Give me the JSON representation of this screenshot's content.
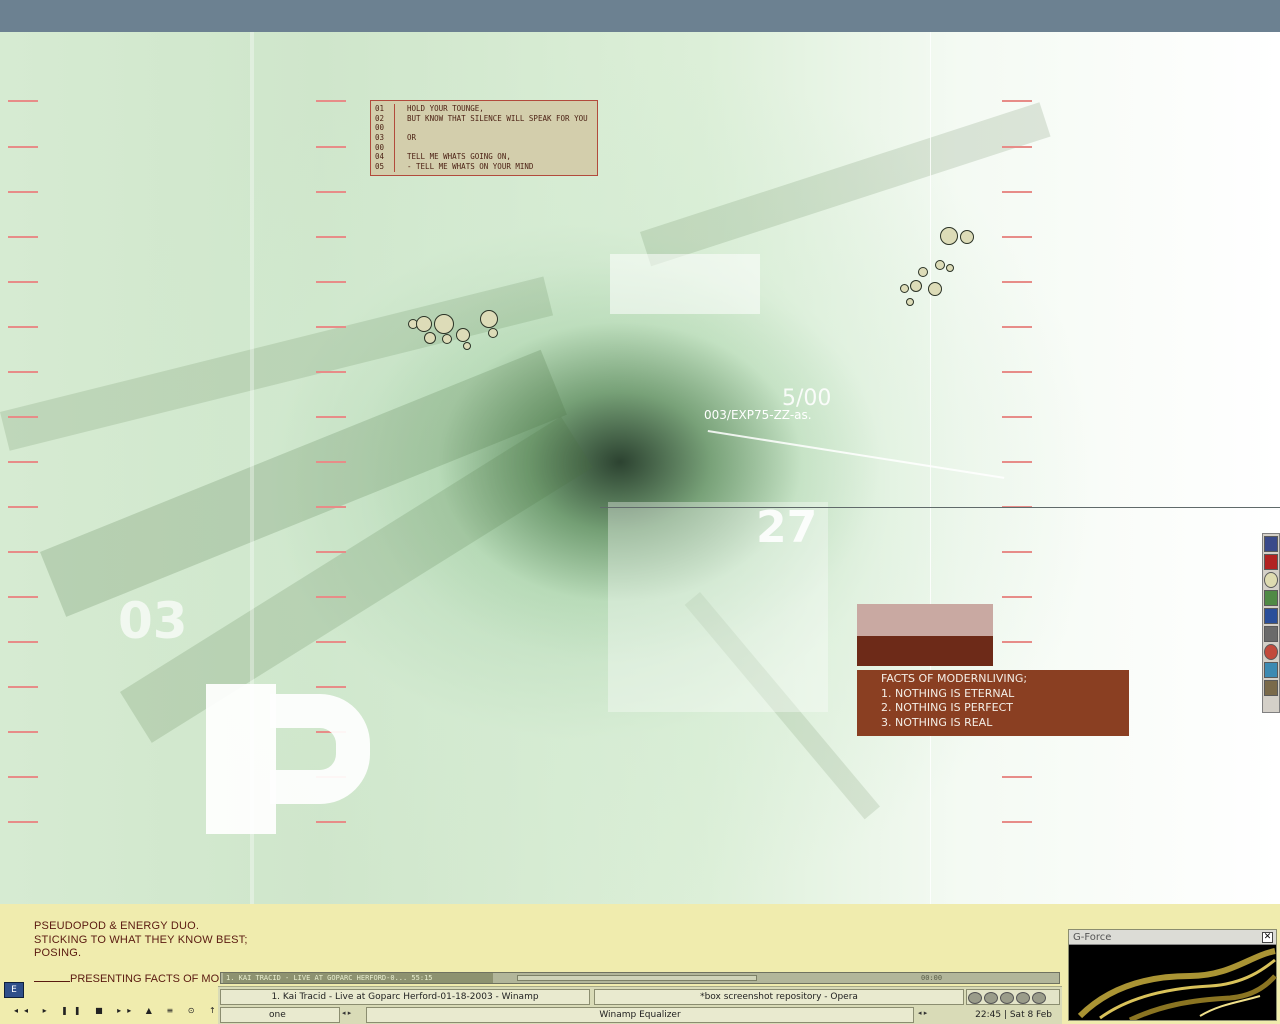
{
  "wallpaper": {
    "quote_numbers": [
      "01",
      "02",
      "00",
      "03",
      "00",
      "04",
      "05"
    ],
    "quote_lines": [
      "HOLD YOUR TOUNGE,",
      "BUT KNOW THAT SILENCE WILL SPEAK FOR YOU",
      "",
      "OR",
      "",
      "TELL ME WHATS GOING ON,",
      "- TELL ME WHATS ON YOUR MIND"
    ],
    "code_small": "003/EXP75-ZZ-as.",
    "code_big": "5/00",
    "big_numeral_date": "03",
    "digits_right": "27",
    "facts_title": "FACTS OF MODERNLIVING;",
    "facts": [
      "1. NOTHING IS ETERNAL",
      "2. NOTHING IS PERFECT",
      "3. NOTHING IS REAL"
    ],
    "motto_lines": [
      "PSEUDOPOD & ENERGY DUO.",
      "STICKING TO WHAT THEY KNOW BEST;",
      "POSING."
    ],
    "presenting": "PRESENTING FACTS OF MODE"
  },
  "player": {
    "track_title": "1. KAI TRACID - LIVE AT GOPARC HERFORD-0... 55:15",
    "time": "00:00",
    "transport_glyphs": "◂◂ ▸ ❚❚ ■ ▸▸ ▲ ≡ ⊙ ↑ ↓"
  },
  "taskbar": {
    "start_label": "E",
    "tasks": [
      "1. Kai Tracid - Live at Goparc Herford-01-18-2003 - Winamp",
      "*box screenshot repository - Opera",
      "one",
      "Winamp Equalizer"
    ],
    "clock": "22:45 | Sat 8 Feb"
  },
  "gforce": {
    "title": "G-Force",
    "close": "✕"
  },
  "icons": {
    "start": "start-icon",
    "tray": [
      "tray-icon-1",
      "tray-icon-2",
      "tray-icon-3",
      "tray-icon-4",
      "tray-icon-5"
    ],
    "toolbar": [
      "toolbar-icon-1",
      "toolbar-icon-2",
      "toolbar-icon-3",
      "toolbar-icon-4",
      "toolbar-icon-5",
      "toolbar-icon-6",
      "toolbar-icon-7",
      "toolbar-icon-8",
      "toolbar-icon-9"
    ]
  },
  "colors": {
    "desktop_top": "#6c8191",
    "facts_box": "#8a3f22",
    "text_strip": "#f0ecae",
    "motto_text": "#5a1a10",
    "taskbar": "#d9dbb7"
  }
}
